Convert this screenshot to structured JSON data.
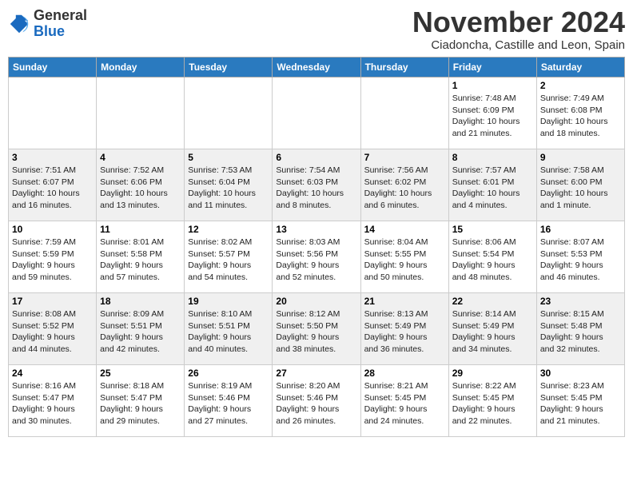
{
  "logo": {
    "general": "General",
    "blue": "Blue"
  },
  "header": {
    "month": "November 2024",
    "location": "Ciadoncha, Castille and Leon, Spain"
  },
  "weekdays": [
    "Sunday",
    "Monday",
    "Tuesday",
    "Wednesday",
    "Thursday",
    "Friday",
    "Saturday"
  ],
  "weeks": [
    [
      {
        "day": "",
        "info": ""
      },
      {
        "day": "",
        "info": ""
      },
      {
        "day": "",
        "info": ""
      },
      {
        "day": "",
        "info": ""
      },
      {
        "day": "",
        "info": ""
      },
      {
        "day": "1",
        "info": "Sunrise: 7:48 AM\nSunset: 6:09 PM\nDaylight: 10 hours\nand 21 minutes."
      },
      {
        "day": "2",
        "info": "Sunrise: 7:49 AM\nSunset: 6:08 PM\nDaylight: 10 hours\nand 18 minutes."
      }
    ],
    [
      {
        "day": "3",
        "info": "Sunrise: 7:51 AM\nSunset: 6:07 PM\nDaylight: 10 hours\nand 16 minutes."
      },
      {
        "day": "4",
        "info": "Sunrise: 7:52 AM\nSunset: 6:06 PM\nDaylight: 10 hours\nand 13 minutes."
      },
      {
        "day": "5",
        "info": "Sunrise: 7:53 AM\nSunset: 6:04 PM\nDaylight: 10 hours\nand 11 minutes."
      },
      {
        "day": "6",
        "info": "Sunrise: 7:54 AM\nSunset: 6:03 PM\nDaylight: 10 hours\nand 8 minutes."
      },
      {
        "day": "7",
        "info": "Sunrise: 7:56 AM\nSunset: 6:02 PM\nDaylight: 10 hours\nand 6 minutes."
      },
      {
        "day": "8",
        "info": "Sunrise: 7:57 AM\nSunset: 6:01 PM\nDaylight: 10 hours\nand 4 minutes."
      },
      {
        "day": "9",
        "info": "Sunrise: 7:58 AM\nSunset: 6:00 PM\nDaylight: 10 hours\nand 1 minute."
      }
    ],
    [
      {
        "day": "10",
        "info": "Sunrise: 7:59 AM\nSunset: 5:59 PM\nDaylight: 9 hours\nand 59 minutes."
      },
      {
        "day": "11",
        "info": "Sunrise: 8:01 AM\nSunset: 5:58 PM\nDaylight: 9 hours\nand 57 minutes."
      },
      {
        "day": "12",
        "info": "Sunrise: 8:02 AM\nSunset: 5:57 PM\nDaylight: 9 hours\nand 54 minutes."
      },
      {
        "day": "13",
        "info": "Sunrise: 8:03 AM\nSunset: 5:56 PM\nDaylight: 9 hours\nand 52 minutes."
      },
      {
        "day": "14",
        "info": "Sunrise: 8:04 AM\nSunset: 5:55 PM\nDaylight: 9 hours\nand 50 minutes."
      },
      {
        "day": "15",
        "info": "Sunrise: 8:06 AM\nSunset: 5:54 PM\nDaylight: 9 hours\nand 48 minutes."
      },
      {
        "day": "16",
        "info": "Sunrise: 8:07 AM\nSunset: 5:53 PM\nDaylight: 9 hours\nand 46 minutes."
      }
    ],
    [
      {
        "day": "17",
        "info": "Sunrise: 8:08 AM\nSunset: 5:52 PM\nDaylight: 9 hours\nand 44 minutes."
      },
      {
        "day": "18",
        "info": "Sunrise: 8:09 AM\nSunset: 5:51 PM\nDaylight: 9 hours\nand 42 minutes."
      },
      {
        "day": "19",
        "info": "Sunrise: 8:10 AM\nSunset: 5:51 PM\nDaylight: 9 hours\nand 40 minutes."
      },
      {
        "day": "20",
        "info": "Sunrise: 8:12 AM\nSunset: 5:50 PM\nDaylight: 9 hours\nand 38 minutes."
      },
      {
        "day": "21",
        "info": "Sunrise: 8:13 AM\nSunset: 5:49 PM\nDaylight: 9 hours\nand 36 minutes."
      },
      {
        "day": "22",
        "info": "Sunrise: 8:14 AM\nSunset: 5:49 PM\nDaylight: 9 hours\nand 34 minutes."
      },
      {
        "day": "23",
        "info": "Sunrise: 8:15 AM\nSunset: 5:48 PM\nDaylight: 9 hours\nand 32 minutes."
      }
    ],
    [
      {
        "day": "24",
        "info": "Sunrise: 8:16 AM\nSunset: 5:47 PM\nDaylight: 9 hours\nand 30 minutes."
      },
      {
        "day": "25",
        "info": "Sunrise: 8:18 AM\nSunset: 5:47 PM\nDaylight: 9 hours\nand 29 minutes."
      },
      {
        "day": "26",
        "info": "Sunrise: 8:19 AM\nSunset: 5:46 PM\nDaylight: 9 hours\nand 27 minutes."
      },
      {
        "day": "27",
        "info": "Sunrise: 8:20 AM\nSunset: 5:46 PM\nDaylight: 9 hours\nand 26 minutes."
      },
      {
        "day": "28",
        "info": "Sunrise: 8:21 AM\nSunset: 5:45 PM\nDaylight: 9 hours\nand 24 minutes."
      },
      {
        "day": "29",
        "info": "Sunrise: 8:22 AM\nSunset: 5:45 PM\nDaylight: 9 hours\nand 22 minutes."
      },
      {
        "day": "30",
        "info": "Sunrise: 8:23 AM\nSunset: 5:45 PM\nDaylight: 9 hours\nand 21 minutes."
      }
    ]
  ]
}
